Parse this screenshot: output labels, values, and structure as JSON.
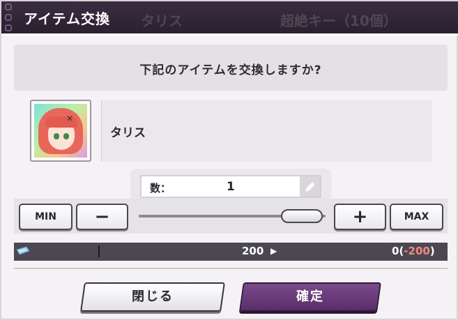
{
  "dialog": {
    "title": "アイテム交換",
    "prompt": "下記のアイテムを交換しますか?"
  },
  "background": {
    "ghost_tab_1": "タリス",
    "ghost_tab_2": "超絶キー（10個）"
  },
  "item": {
    "name": "タリス"
  },
  "quantity": {
    "label": "数：",
    "value": "1"
  },
  "controls": {
    "min_label": "MIN",
    "minus_label": "−",
    "plus_label": "+",
    "max_label": "MAX",
    "slider_fraction": 1.0
  },
  "cost": {
    "current": "200",
    "result": "0",
    "delta": "-200",
    "delta_color": "#f4887e"
  },
  "buttons": {
    "close_label": "閉じる",
    "confirm_label": "確定",
    "confirm_color": "#5a2e6a"
  }
}
